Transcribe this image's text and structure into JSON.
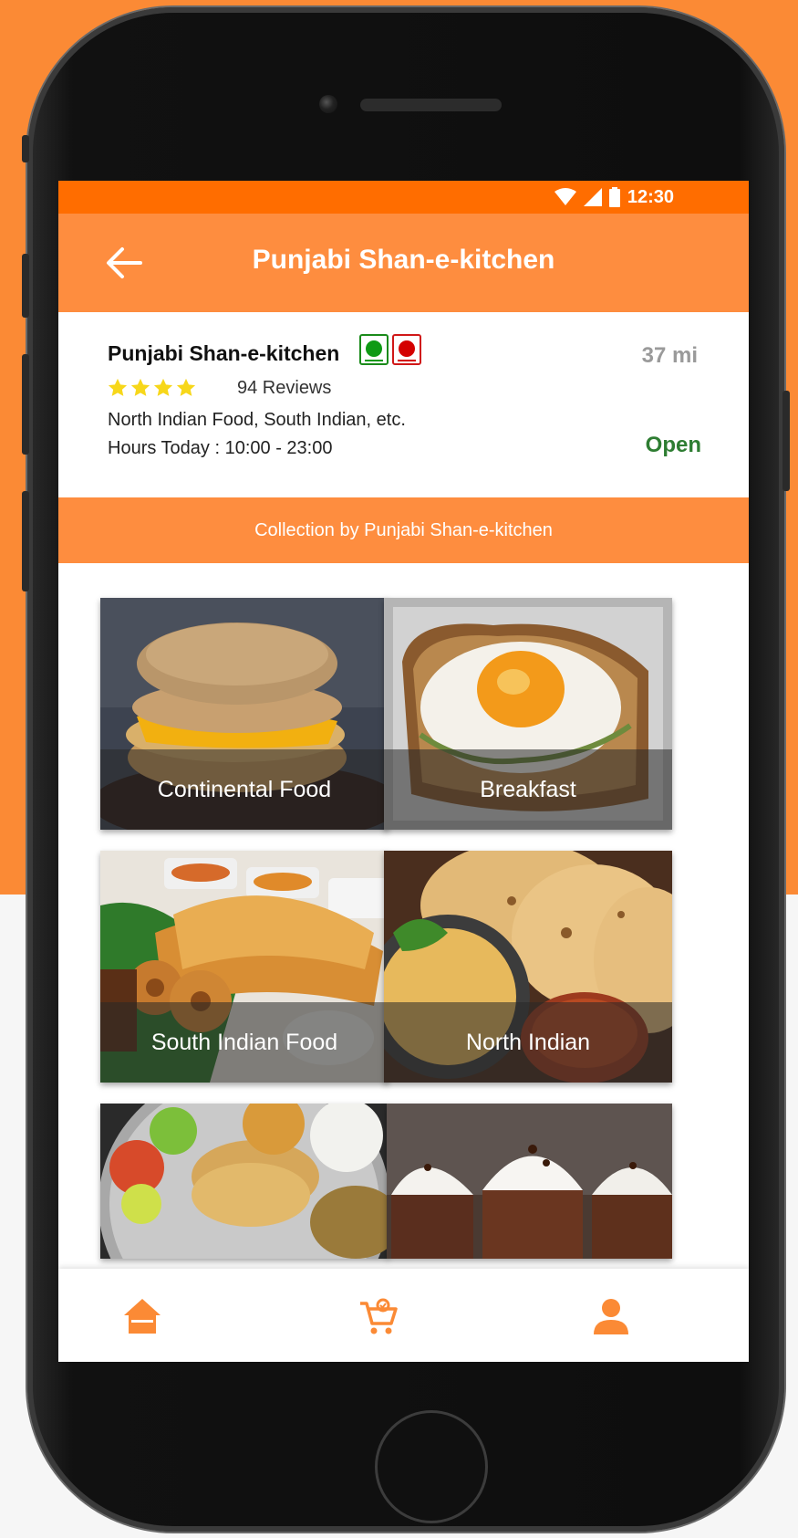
{
  "status_bar": {
    "time": "12:30"
  },
  "app_bar": {
    "title": "Punjabi Shan-e-kitchen"
  },
  "restaurant": {
    "name": "Punjabi Shan-e-kitchen",
    "distance": "37 mi",
    "rating": 4,
    "reviews": "94 Reviews",
    "cuisines": "North Indian Food, South Indian, etc.",
    "hours": "Hours Today : 10:00 - 23:00",
    "status": "Open"
  },
  "collection": {
    "title": "Collection by Punjabi Shan-e-kitchen"
  },
  "categories": [
    {
      "label": "Continental Food"
    },
    {
      "label": "Breakfast"
    },
    {
      "label": "South Indian Food"
    },
    {
      "label": "North Indian"
    },
    {
      "label": ""
    },
    {
      "label": ""
    }
  ],
  "bottom_nav": {
    "items": [
      {
        "icon": "home-icon"
      },
      {
        "icon": "cart-icon"
      },
      {
        "icon": "profile-icon"
      }
    ]
  },
  "colors": {
    "accent": "#fe8d3f",
    "status_bar": "#ff6d00",
    "open": "#2e7d32"
  }
}
